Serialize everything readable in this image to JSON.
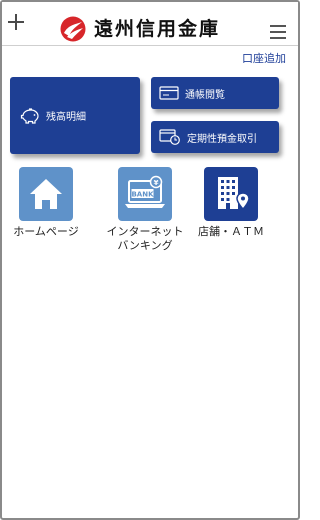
{
  "header": {
    "brand": "遠州信用金庫",
    "add_account": "口座追加"
  },
  "tiles": {
    "balance": "残高明細",
    "passbook": "通帳閲覧",
    "time_deposit": "定期性預金取引"
  },
  "shortcuts": {
    "homepage": "ホームページ",
    "internet_banking_line1": "インターネット",
    "internet_banking_line2": "バンキング",
    "branch_atm": "店舗・ＡＴＭ",
    "bank_sign": "BANK",
    "yen": "¥"
  },
  "icons": {
    "menu": "plus-icon",
    "logo": "enshin-logo-icon",
    "hamburger": "hamburger-menu-icon",
    "balance": "piggy-bank-icon",
    "passbook": "passbook-icon",
    "time_deposit": "deposit-clock-icon",
    "homepage": "house-icon",
    "internet_banking": "laptop-bank-icon",
    "branch_atm": "building-location-icon"
  },
  "colors": {
    "brand_navy": "#1e3f94",
    "light_blue": "#5f92c9",
    "logo_red": "#d7262a",
    "link_blue": "#1f3f99"
  }
}
